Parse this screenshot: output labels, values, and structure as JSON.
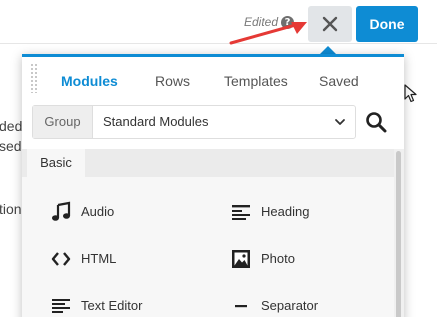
{
  "toolbar": {
    "edited_label": "Edited",
    "help_glyph": "?",
    "done_label": "Done"
  },
  "background_text": [
    "ded",
    "sed",
    "tion"
  ],
  "panel": {
    "tabs": [
      {
        "label": "Modules",
        "active": true
      },
      {
        "label": "Rows",
        "active": false
      },
      {
        "label": "Templates",
        "active": false
      },
      {
        "label": "Saved",
        "active": false
      }
    ],
    "group": {
      "label": "Group",
      "value": "Standard Modules"
    },
    "section_title": "Basic",
    "modules": [
      {
        "label": "Audio",
        "icon": "music-note-icon"
      },
      {
        "label": "Heading",
        "icon": "heading-lines-icon"
      },
      {
        "label": "HTML",
        "icon": "code-brackets-icon"
      },
      {
        "label": "Photo",
        "icon": "photo-icon"
      },
      {
        "label": "Text Editor",
        "icon": "text-editor-icon"
      },
      {
        "label": "Separator",
        "icon": "separator-line-icon"
      }
    ]
  },
  "colors": {
    "accent": "#0e8cd4",
    "annotation_arrow": "#e53935"
  }
}
